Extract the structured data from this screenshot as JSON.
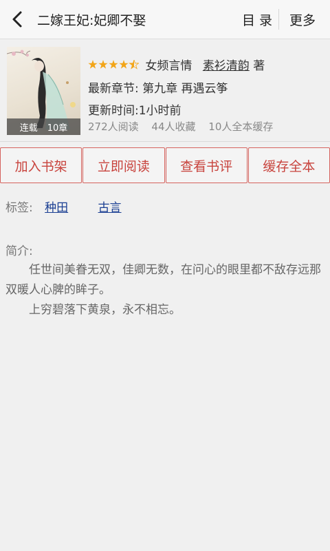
{
  "header": {
    "title": "二嫁王妃:妃卿不娶",
    "catalog_label": "目 录",
    "more_label": "更多"
  },
  "book": {
    "cover_status": "连载",
    "cover_chapters": "10章",
    "rating": 4.5,
    "category": "女频言情",
    "author": "素衫清韵",
    "author_suffix": "著",
    "latest_chapter": "最新章节: 第九章 再遇云筝",
    "update_time": "更新时间:1小时前",
    "reads": "272人阅读",
    "favorites": "44人收藏",
    "cached": "10人全本缓存"
  },
  "actions": {
    "add_shelf": "加入书架",
    "read_now": "立即阅读",
    "view_reviews": "查看书评",
    "cache_all": "缓存全本"
  },
  "tags": {
    "label": "标签:",
    "items": [
      "种田",
      "古言"
    ]
  },
  "intro": {
    "label": "简介:",
    "paragraphs": [
      "任世间美眷无双，佳卿无数，在问心的眼里都不敌存远那双暖人心脾的眸子。",
      "上穷碧落下黄泉，永不相忘。"
    ]
  },
  "colors": {
    "accent": "#c8433d",
    "star": "#f2a518",
    "tag_link": "#1b3f93"
  }
}
